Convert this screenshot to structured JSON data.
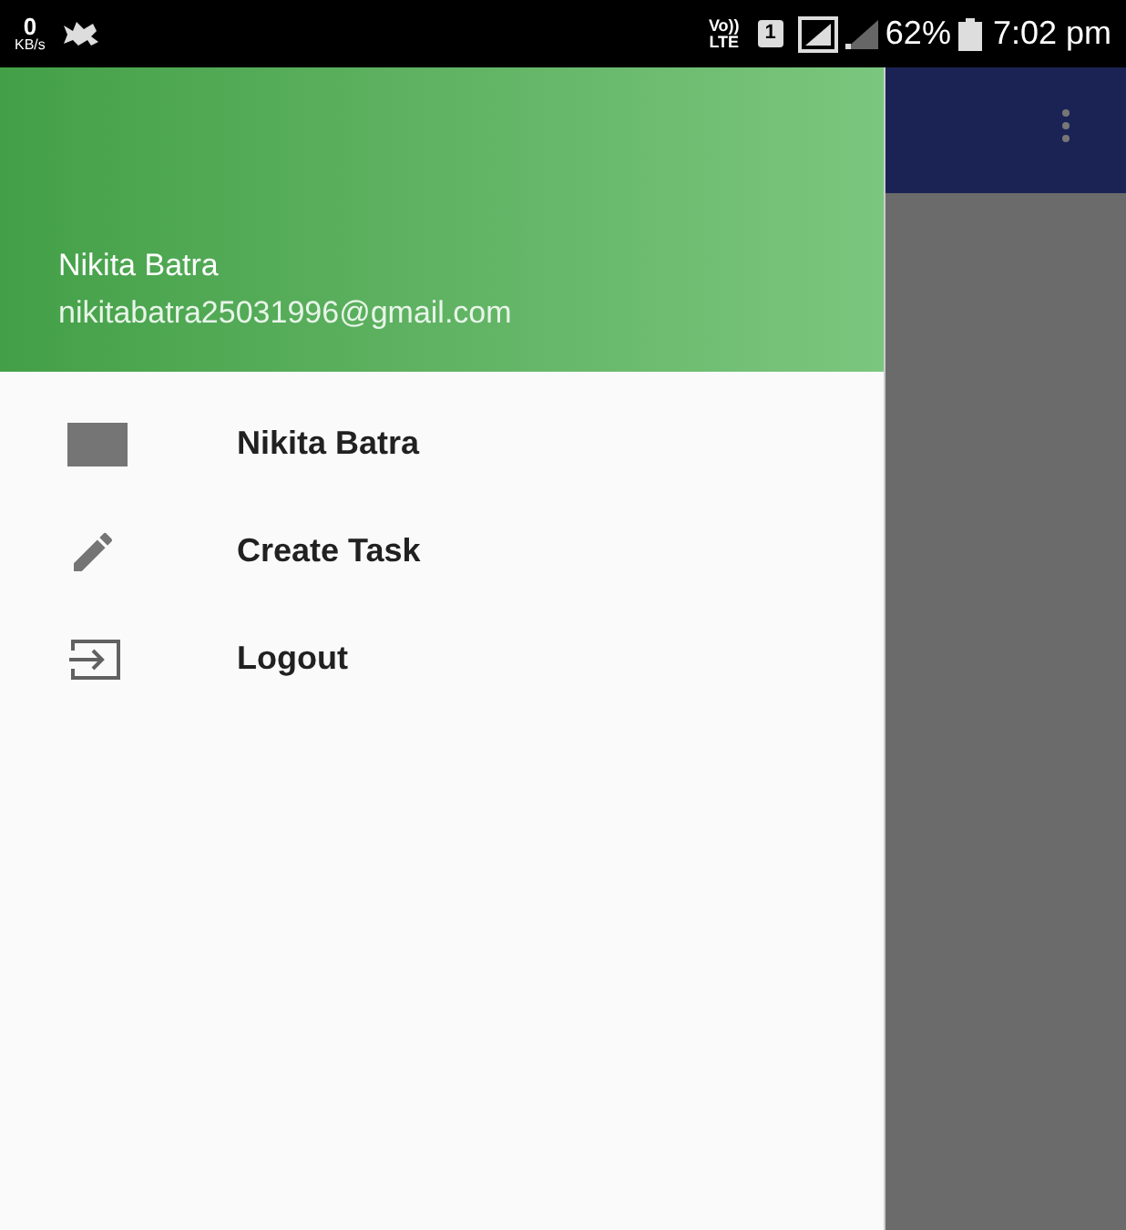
{
  "status_bar": {
    "speed": "0",
    "speed_unit": "KB/s",
    "volte_top": "Vo))",
    "volte_bottom": "LTE",
    "sim": "1",
    "battery": "62%",
    "time": "7:02 pm"
  },
  "drawer": {
    "header": {
      "name": "Nikita Batra",
      "email": "nikitabatra25031996@gmail.com"
    },
    "items": [
      {
        "kind": "profile",
        "label": "Nikita Batra"
      },
      {
        "kind": "edit",
        "label": "Create Task"
      },
      {
        "kind": "logout",
        "label": "Logout"
      }
    ]
  }
}
